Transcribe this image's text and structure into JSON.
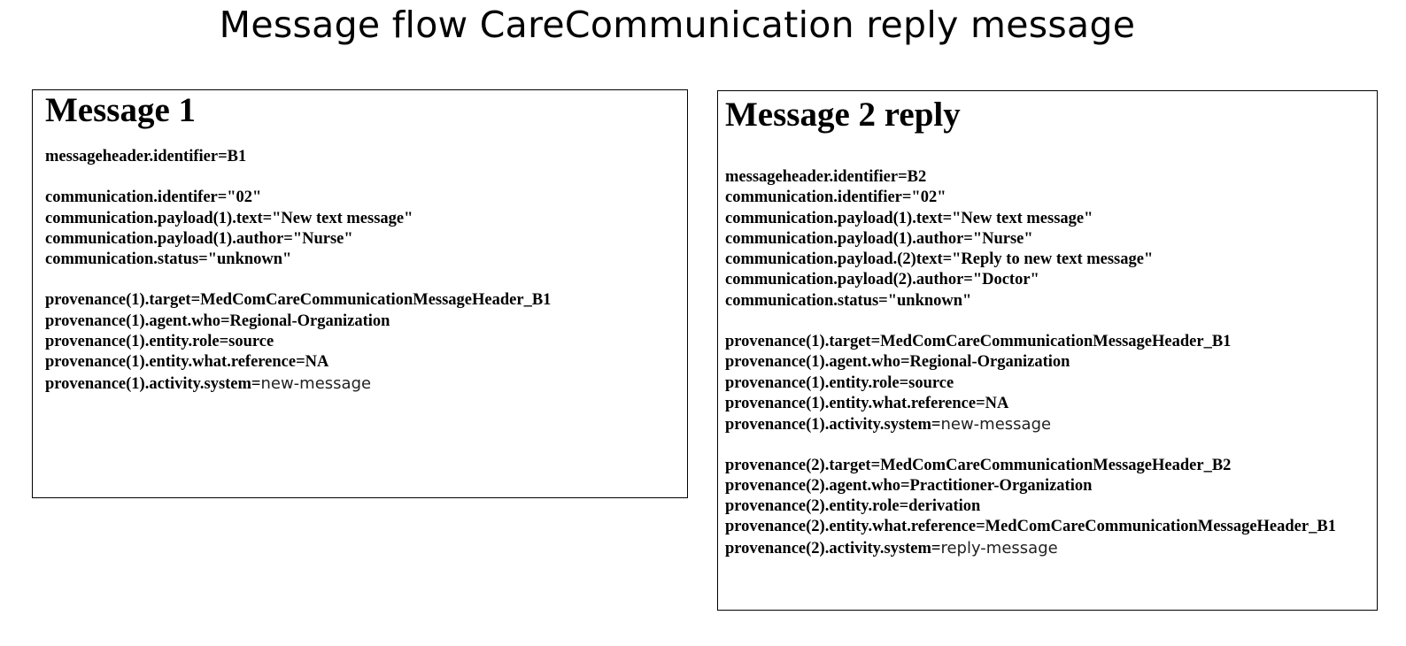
{
  "title": "Message flow CareCommunication reply message",
  "message1": {
    "heading": "Message 1",
    "groups": [
      [
        {
          "text": "messageheader.identifier=B1"
        }
      ],
      [
        {
          "text": "communication.identifer=\"02\""
        },
        {
          "text": "communication.payload(1).text=\"New text message\""
        },
        {
          "text": "communication.payload(1).author=\"Nurse\""
        },
        {
          "text": "communication.status=\"unknown\""
        }
      ],
      [
        {
          "text": "provenance(1).target=MedComCareCommunicationMessageHeader_B1"
        },
        {
          "text": "provenance(1).agent.who=Regional-Organization"
        },
        {
          "text": "provenance(1).entity.role=source"
        },
        {
          "text": "provenance(1).entity.what.reference=NA"
        },
        {
          "text": "provenance(1).activity.system=",
          "suffix": "new-message"
        }
      ]
    ]
  },
  "message2": {
    "heading": "Message 2 reply",
    "groups": [
      [
        {
          "text": "messageheader.identifier=B2"
        },
        {
          "text": "communication.identifier=\"02\""
        },
        {
          "text": "communication.payload(1).text=\"New text message\""
        },
        {
          "text": "communication.payload(1).author=\"Nurse\""
        },
        {
          "text": "communication.payload.(2)text=\"Reply to new text message\""
        },
        {
          "text": "communication.payload(2).author=\"Doctor\""
        },
        {
          "text": "communication.status=\"unknown\""
        }
      ],
      [
        {
          "text": "provenance(1).target=MedComCareCommunicationMessageHeader_B1"
        },
        {
          "text": "provenance(1).agent.who=Regional-Organization"
        },
        {
          "text": "provenance(1).entity.role=source"
        },
        {
          "text": "provenance(1).entity.what.reference=NA"
        },
        {
          "text": "provenance(1).activity.system=",
          "suffix": "new-message"
        }
      ],
      [
        {
          "text": "provenance(2).target=MedComCareCommunicationMessageHeader_B2"
        },
        {
          "text": "provenance(2).agent.who=Practitioner-Organization"
        },
        {
          "text": "provenance(2).entity.role=derivation"
        },
        {
          "text": "provenance(2).entity.what.reference=MedComCareCommunicationMessageHeader_B1"
        },
        {
          "text": "provenance(2).activity.system=",
          "suffix": "reply-message"
        }
      ]
    ]
  }
}
